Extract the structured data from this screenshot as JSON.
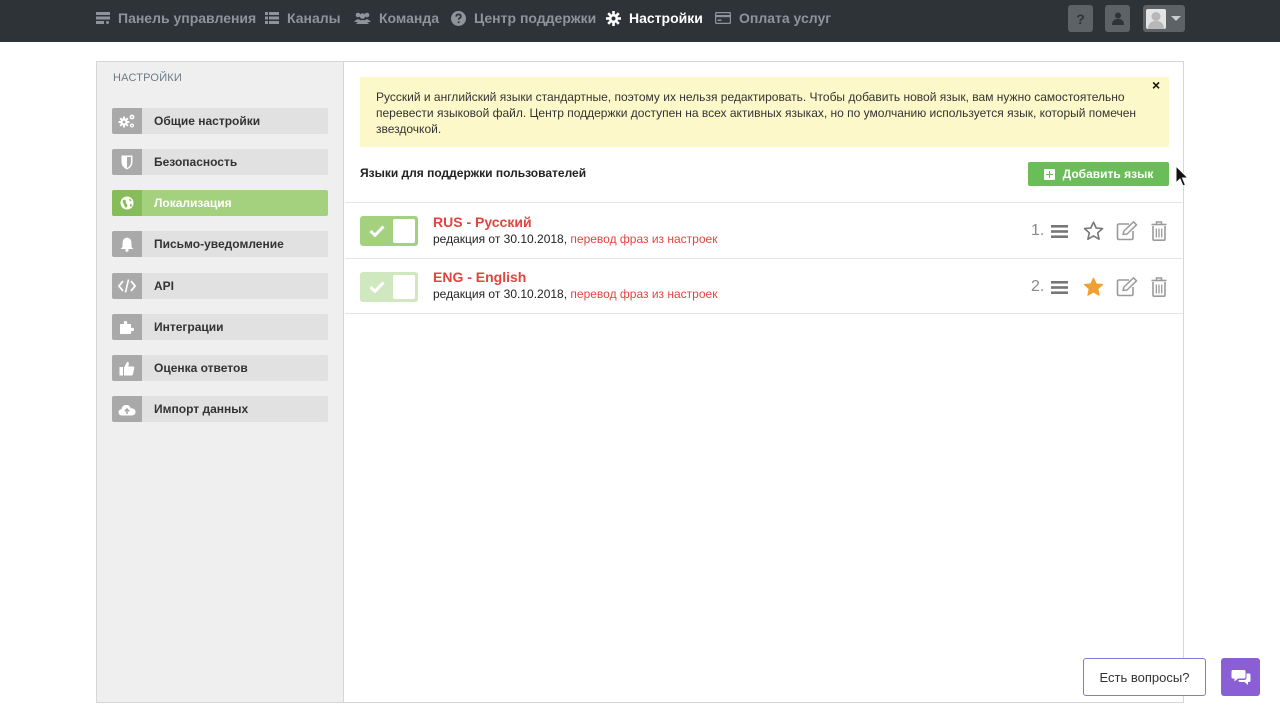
{
  "nav": {
    "items": [
      {
        "label": "Панель управления",
        "icon": "dashboard-icon"
      },
      {
        "label": "Каналы",
        "icon": "list-icon"
      },
      {
        "label": "Команда",
        "icon": "users-icon"
      },
      {
        "label": "Центр поддержки",
        "icon": "help-circle-icon"
      },
      {
        "label": "Настройки",
        "icon": "gear-icon",
        "active": true
      },
      {
        "label": "Оплата услуг",
        "icon": "credit-card-icon"
      }
    ],
    "help_button": "?",
    "colors": {
      "bar": "#2e3338",
      "inactive": "#8e949a",
      "active": "#ffffff"
    }
  },
  "sidebar": {
    "title": "НАСТРОЙКИ",
    "items": [
      {
        "label": "Общие настройки",
        "icon": "gears-icon"
      },
      {
        "label": "Безопасность",
        "icon": "shield-icon"
      },
      {
        "label": "Локализация",
        "icon": "globe-icon",
        "active": true
      },
      {
        "label": "Письмо-уведомление",
        "icon": "bell-icon"
      },
      {
        "label": "API",
        "icon": "code-icon"
      },
      {
        "label": "Интеграции",
        "icon": "puzzle-icon"
      },
      {
        "label": "Оценка ответов",
        "icon": "thumbs-up-icon"
      },
      {
        "label": "Импорт данных",
        "icon": "cloud-upload-icon"
      }
    ]
  },
  "alert": {
    "text": "Русский и английский языки стандартные, поэтому их нельзя редактировать. Чтобы добавить новой язык, вам нужно самостоятельно перевести языковой файл. Центр поддержки доступен на всех активных языках, но по умолчанию используется язык, который помечен звездочкой.",
    "close": "×"
  },
  "languages": {
    "title": "Языки для поддержки пользователей",
    "add_button": "Добавить язык",
    "items": [
      {
        "order": "1.",
        "name": "RUS - Русский",
        "meta": "редакция от 30.10.2018,",
        "link": "перевод фраз из настроек",
        "enabled": true,
        "default": false
      },
      {
        "order": "2.",
        "name": "ENG - English",
        "meta": "редакция от 30.10.2018,",
        "link": "перевод фраз из настроек",
        "enabled": true,
        "default": true
      }
    ]
  },
  "help_widget": {
    "label": "Есть вопросы?",
    "icon": "chat-icon"
  },
  "colors": {
    "accent_green": "#6bbd5a",
    "active_sidebar": "#a4d17d",
    "link_red": "#e0453f",
    "star_orange": "#f0a030",
    "alert_bg": "#fdf8c9",
    "chat_purple": "#8a5fd5"
  }
}
